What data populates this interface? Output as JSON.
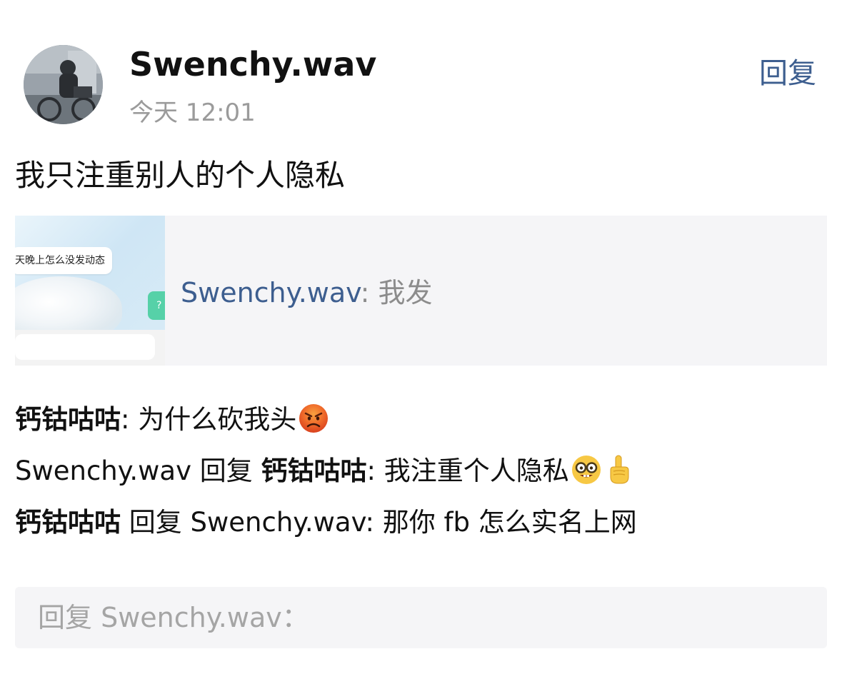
{
  "post": {
    "author": "Swenchy.wav",
    "time": "今天 12:01",
    "reply_label": "回复",
    "text": "我只注重别人的个人隐私",
    "avatar_icon": "avatar-photo"
  },
  "shared": {
    "thumb_text": "天晚上怎么没发动态",
    "thumb_badge": "?",
    "author": "Swenchy.wav",
    "separator": ":",
    "text": " 我发"
  },
  "comments": [
    {
      "user": "钙钴咕咕",
      "sep": ": ",
      "text": "为什么砍我头",
      "emoji": [
        "angry-face-emoji"
      ]
    },
    {
      "user": "Swenchy.wav",
      "reply_word": " 回复 ",
      "target": "钙钴咕咕",
      "sep": ": ",
      "text": "我注重个人隐私",
      "emoji": [
        "nerd-face-emoji",
        "index-pointing-up-emoji"
      ]
    },
    {
      "user": "钙钴咕咕",
      "reply_word": " 回复 ",
      "target": "Swenchy.wav",
      "sep": ": ",
      "text": "那你 fb 怎么实名上网"
    }
  ],
  "reply_input": {
    "placeholder": "回复 Swenchy.wav："
  },
  "colors": {
    "link": "#3d5e8f",
    "muted": "#9b9b9b",
    "card_bg": "#f5f5f7"
  }
}
